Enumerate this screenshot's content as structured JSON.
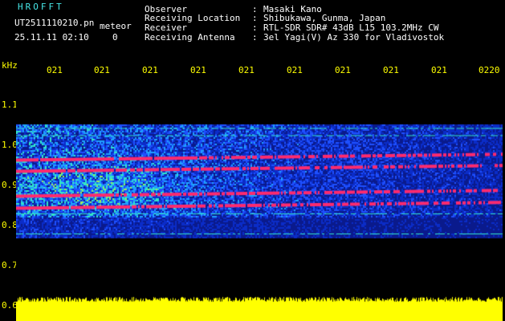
{
  "header": {
    "program": "HROFFT",
    "filename": "UT2511110210.pn",
    "type": "meteor",
    "datetime": "25.11.11 02:10",
    "zero": "0",
    "fields": [
      {
        "label": "Observer",
        "value": "Masaki Kano"
      },
      {
        "label": "Receiving Location",
        "value": "Shibukawa, Gunma, Japan"
      },
      {
        "label": "Receiver",
        "value": "RTL-SDR SDR# 43dB L15 103.2MHz CW"
      },
      {
        "label": "Receiving Antenna",
        "value": "3el Yagi(V) Az 330 for Vladivostok"
      }
    ]
  },
  "axes": {
    "y_unit": "kHz",
    "y_ticks": [
      "1.1",
      "1.0",
      "0.9",
      "0.8",
      "0.7",
      "0.6"
    ],
    "x_ticks": [
      "021",
      "021",
      "021",
      "021",
      "021",
      "021",
      "021",
      "021",
      "021",
      "0220"
    ]
  },
  "spectrogram": {
    "freq_range_khz": [
      0.6,
      1.1
    ],
    "noise_band_khz": [
      0.77,
      1.05
    ],
    "signal_lines_khz": [
      0.963,
      0.935,
      0.873,
      0.843
    ],
    "weak_lines_khz": [
      1.043,
      1.025,
      0.83,
      0.78
    ],
    "amplitude_fill": 0.9,
    "colors": {
      "background": "#000000",
      "noise_dark": "#0a1a8c",
      "noise_mid": "#1e50ff",
      "noise_bright": "#32e6c8",
      "hot": "#ff2a6e",
      "amplitude": "#ffff00"
    }
  }
}
